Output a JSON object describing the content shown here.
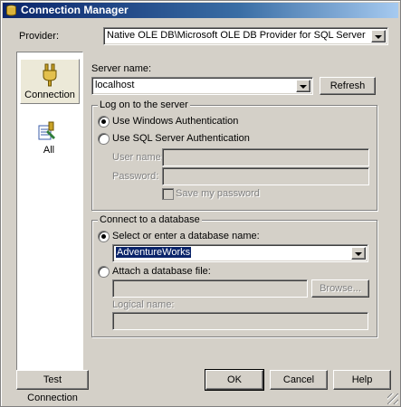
{
  "window": {
    "title": "Connection Manager"
  },
  "provider": {
    "label": "Provider:",
    "value": "Native OLE DB\\Microsoft OLE DB Provider for SQL Server"
  },
  "sidebar": {
    "items": [
      {
        "label": "Connection",
        "icon": "connection-plug-icon",
        "selected": true
      },
      {
        "label": "All",
        "icon": "all-properties-icon",
        "selected": false
      }
    ]
  },
  "server": {
    "label": "Server name:",
    "value": "localhost",
    "refresh_label": "Refresh"
  },
  "logon": {
    "group_title": "Log on to the server",
    "windows_auth_label": "Use Windows Authentication",
    "sql_auth_label": "Use SQL Server Authentication",
    "selected": "windows",
    "user_name_label": "User name:",
    "user_name_value": "",
    "password_label": "Password:",
    "password_value": "",
    "save_password_label": "Save my password",
    "save_password_checked": false
  },
  "database": {
    "group_title": "Connect to a database",
    "select_label": "Select or enter a database name:",
    "selected_db": "AdventureWorks",
    "attach_label": "Attach a database file:",
    "attach_value": "",
    "browse_label": "Browse...",
    "logical_name_label": "Logical name:",
    "logical_name_value": "",
    "selected": "select"
  },
  "buttons": {
    "test_connection": "Test Connection",
    "ok": "OK",
    "cancel": "Cancel",
    "help": "Help"
  }
}
